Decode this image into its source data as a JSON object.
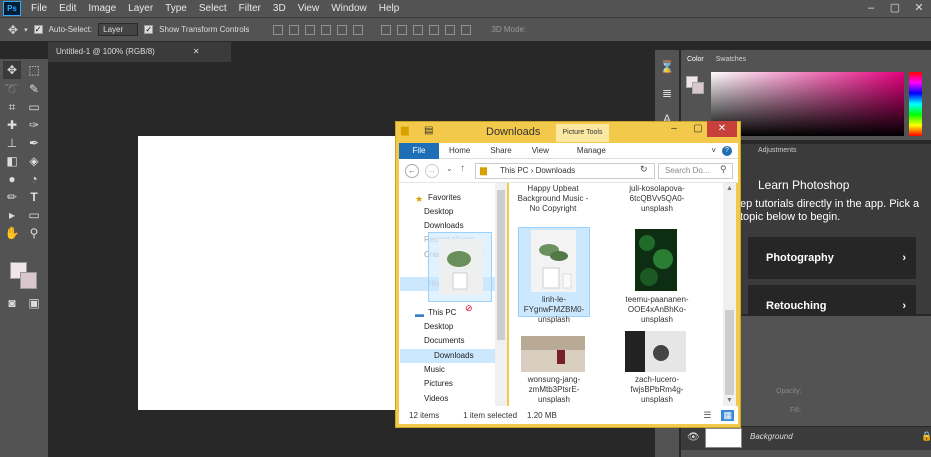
{
  "ps": {
    "logo": "Ps",
    "menu": [
      "File",
      "Edit",
      "Image",
      "Layer",
      "Type",
      "Select",
      "Filter",
      "3D",
      "View",
      "Window",
      "Help"
    ],
    "options": {
      "auto_select": "Auto-Select:",
      "layer_value": "Layer",
      "show_transform": "Show Transform Controls",
      "mode_3d": "3D Mode:"
    },
    "doc_tab": "Untitled-1 @ 100% (RGB/8)",
    "panels": {
      "color_tab": "Color",
      "swatches_tab": "Swatches",
      "adjustments_tab": "Adjustments",
      "learn_title": "Learn Photoshop",
      "learn_desc": "ep tutorials directly in the app. Pick a topic below to begin.",
      "cards": [
        "Photography",
        "Retouching"
      ],
      "opacity": "Opacity:",
      "fill": "Fill:",
      "background_layer": "Background"
    }
  },
  "explorer": {
    "title": "Downloads",
    "picture_tools": "Picture Tools",
    "ribbon": {
      "file": "File",
      "tabs": [
        "Home",
        "Share",
        "View"
      ],
      "manage": "Manage"
    },
    "address": {
      "root": "This PC",
      "folder": "Downloads"
    },
    "search_placeholder": "Search Do...",
    "nav": {
      "favorites": "Favorites",
      "fav_items": [
        "Desktop",
        "Downloads",
        "Recent places",
        "Creative Cloud F"
      ],
      "homegroup": "Homegroup",
      "this_pc": "This PC",
      "pc_items": [
        "Desktop",
        "Documents",
        "Downloads",
        "Music",
        "Pictures",
        "Videos"
      ]
    },
    "files": [
      "Happy Upbeat Background Music - No Copyright",
      "juli-kosolapova-6tcQBVv5QA0-unsplash",
      "linh-le-FYgnwFMZBM0-unsplash",
      "teemu-paananen-OOE4xAnBhKo-unsplash",
      "wonsung-jang-zmMtb3PtsrE-unsplash",
      "zach-lucero-fwjsBPbRm4g-unsplash"
    ],
    "status": {
      "count": "12 items",
      "selected": "1 item selected",
      "size": "1.20 MB"
    }
  }
}
